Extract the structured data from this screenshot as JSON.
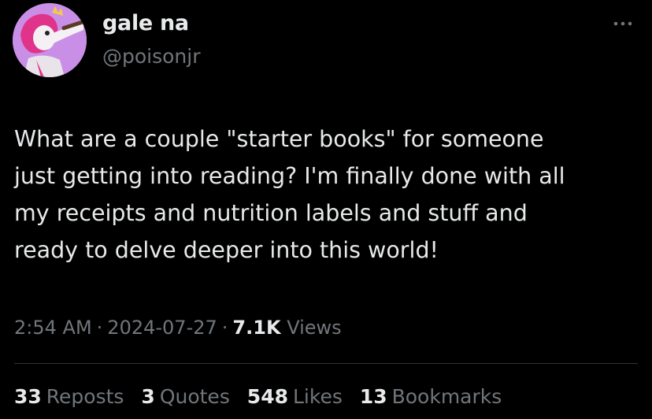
{
  "user": {
    "display_name": "gale na",
    "handle": "@poisonjr"
  },
  "tweet": {
    "text_lines": [
      "What are a couple \"starter books\" for someone",
      "just getting into reading? I'm finally done with all",
      "my receipts and nutrition labels and stuff and",
      "ready to delve deeper into this world!"
    ],
    "time": "2:54 AM",
    "date": "2024-07-27",
    "separator": "·",
    "views_count": "7.1K",
    "views_label": "Views"
  },
  "stats": [
    {
      "count": "33",
      "label": "Reposts"
    },
    {
      "count": "3",
      "label": "Quotes"
    },
    {
      "count": "548",
      "label": "Likes"
    },
    {
      "count": "13",
      "label": "Bookmarks"
    }
  ],
  "icons": {
    "more": "more-horizontal-icon",
    "avatar": "avatar-cartoon-character"
  },
  "colors": {
    "background": "#000000",
    "primary_text": "#e7e9ea",
    "secondary_text": "#71767b",
    "divider": "#2f3336",
    "avatar_bg": "#c98fe6"
  }
}
